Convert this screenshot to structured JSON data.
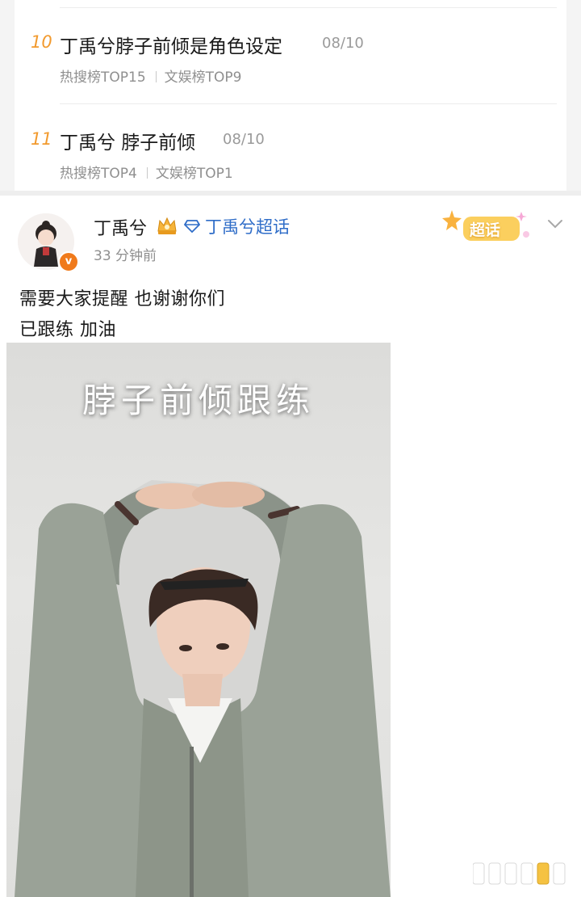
{
  "trending": [
    {
      "rank": "10",
      "title": "丁禹兮脖子前倾是角色设定",
      "date": "08/10",
      "hot_search": "热搜榜TOP15",
      "ent": "文娱榜TOP9"
    },
    {
      "rank": "11",
      "title": "丁禹兮 脖子前倾",
      "date": "08/10",
      "hot_search": "热搜榜TOP4",
      "ent": "文娱榜TOP1"
    }
  ],
  "post": {
    "username": "丁禹兮",
    "super_topic": "丁禹兮超话",
    "time": "33 分钟前",
    "super_badge": "超话",
    "text_line1": "需要大家提醒 也谢谢你们",
    "text_line2": "已跟练 加油",
    "image_caption": "脖子前倾跟练",
    "verify_badge": "v"
  },
  "colors": {
    "rank": "#f29a2e",
    "link": "#2f6dc8",
    "meta": "#8f8f8f",
    "verify": "#f07a1b"
  },
  "icons": [
    "crown-icon",
    "diamond-icon",
    "chevron-down-icon",
    "super-topic-badge-icon"
  ]
}
